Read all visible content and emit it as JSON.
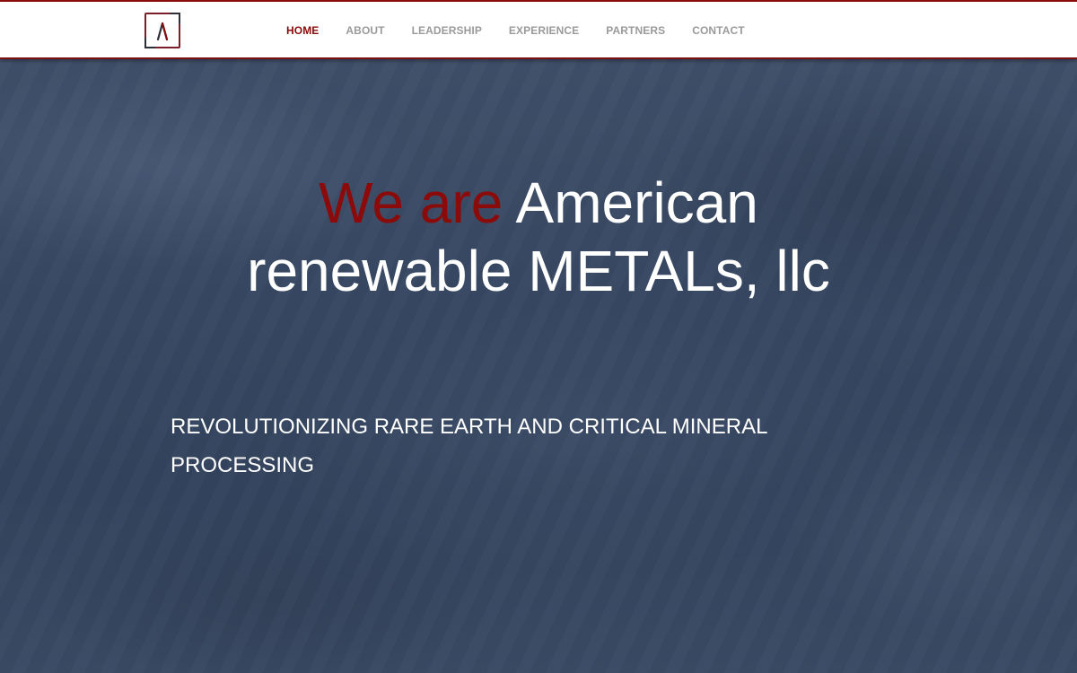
{
  "header": {
    "logo_icon": "angle-mark-logo-icon",
    "nav": [
      {
        "label": "HOME",
        "active": true
      },
      {
        "label": "ABOUT",
        "active": false
      },
      {
        "label": "LEADERSHIP",
        "active": false
      },
      {
        "label": "EXPERIENCE",
        "active": false
      },
      {
        "label": "PARTNERS",
        "active": false
      },
      {
        "label": "CONTACT",
        "active": false
      }
    ]
  },
  "hero": {
    "headline_accent": "We are",
    "headline_rest": "American renewable METALs, llc",
    "tagline": "REVOLUTIONIZING RARE EARTH AND CRITICAL MINERAL PROCESSING"
  },
  "colors": {
    "brand_red": "#8b0a0a",
    "nav_gray": "#9a9a9a",
    "hero_bg": "#3a4a63",
    "text_white": "#ffffff"
  }
}
